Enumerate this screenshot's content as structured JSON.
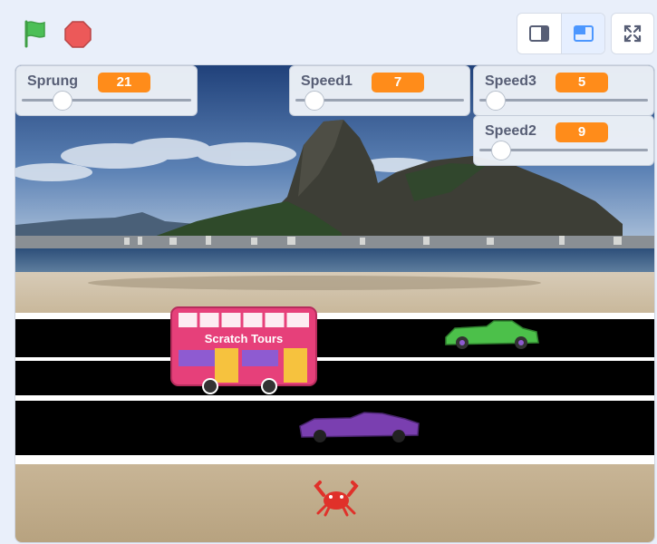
{
  "toolbar": {
    "green_flag_icon": "green-flag-icon",
    "stop_icon": "stop-sign-icon",
    "small_stage_icon": "small-stage-icon",
    "normal_stage_icon": "normal-stage-icon",
    "fullscreen_icon": "fullscreen-icon"
  },
  "monitors": [
    {
      "label": "Sprung",
      "value": "21"
    },
    {
      "label": "Speed1",
      "value": "7"
    },
    {
      "label": "Speed3",
      "value": "5"
    },
    {
      "label": "Speed2",
      "value": "9"
    }
  ],
  "sprites": {
    "bus_text": "Scratch Tours"
  },
  "colors": {
    "flag_green": "#4cbf56",
    "stop_red": "#ec5959",
    "monitor_value": "#ff8c1a",
    "active_mode_bg": "#e6efff",
    "road": "#000000",
    "bus_pink": "#e6407a",
    "car_green": "#4cc04a",
    "car_purple": "#7a3fb0",
    "crab_red": "#e0312a"
  }
}
